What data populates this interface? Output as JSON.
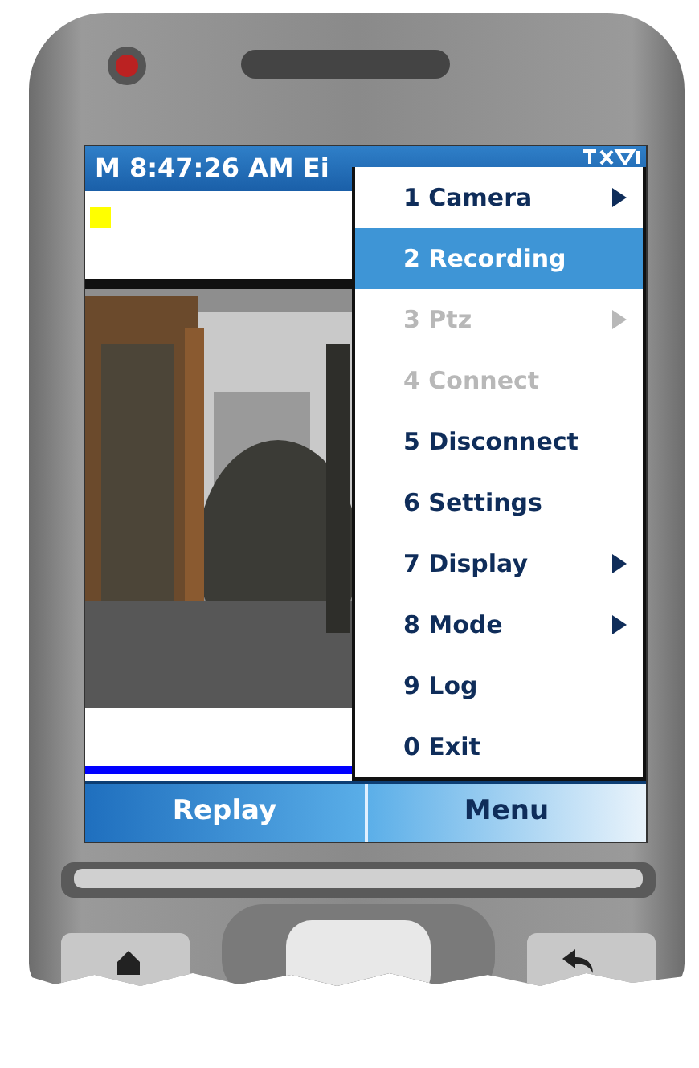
{
  "title_bar": {
    "title": "M 8:47:26 AM Ei"
  },
  "menu": [
    {
      "label": "1 Camera",
      "submenu": true,
      "disabled": false,
      "selected": false
    },
    {
      "label": "2 Recording",
      "submenu": false,
      "disabled": false,
      "selected": true
    },
    {
      "label": "3 Ptz",
      "submenu": true,
      "disabled": true,
      "selected": false
    },
    {
      "label": "4 Connect",
      "submenu": false,
      "disabled": true,
      "selected": false
    },
    {
      "label": "5 Disconnect",
      "submenu": false,
      "disabled": false,
      "selected": false
    },
    {
      "label": "6 Settings",
      "submenu": false,
      "disabled": false,
      "selected": false
    },
    {
      "label": "7 Display",
      "submenu": true,
      "disabled": false,
      "selected": false
    },
    {
      "label": "8 Mode",
      "submenu": true,
      "disabled": false,
      "selected": false
    },
    {
      "label": "9 Log",
      "submenu": false,
      "disabled": false,
      "selected": false
    },
    {
      "label": "0 Exit",
      "submenu": false,
      "disabled": false,
      "selected": false
    }
  ],
  "softkeys": [
    {
      "label": "Replay"
    },
    {
      "label": "Menu"
    }
  ]
}
